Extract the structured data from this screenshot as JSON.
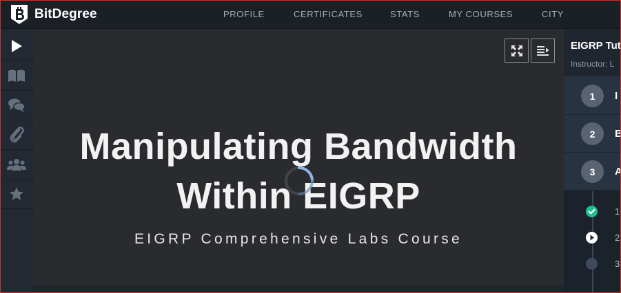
{
  "brand": {
    "name": "BitDegree"
  },
  "nav": {
    "items": [
      "PROFILE",
      "CERTIFICATES",
      "STATS",
      "MY COURSES",
      "CITY"
    ]
  },
  "sidebar": {
    "items": [
      {
        "name": "play-icon",
        "active": true
      },
      {
        "name": "book-icon",
        "active": false
      },
      {
        "name": "chat-icon",
        "active": false
      },
      {
        "name": "paperclip-icon",
        "active": false
      },
      {
        "name": "users-icon",
        "active": false
      },
      {
        "name": "star-icon",
        "active": false
      }
    ]
  },
  "video": {
    "title_line1": "Manipulating Bandwidth",
    "title_line2": "Within EIGRP",
    "subtitle": "EIGRP Comprehensive Labs Course",
    "controls": [
      "fullscreen-icon",
      "playlist-icon"
    ],
    "loading": true
  },
  "course_panel": {
    "title": "EIGRP Tut",
    "instructor": "Instructor: L",
    "sections": [
      {
        "number": "1",
        "initial": "I"
      },
      {
        "number": "2",
        "initial": "B"
      },
      {
        "number": "3",
        "initial": "A"
      }
    ],
    "lessons": [
      {
        "number": "1",
        "status": "completed"
      },
      {
        "number": "2",
        "status": "playing"
      },
      {
        "number": "3",
        "status": "pending"
      }
    ]
  },
  "colors": {
    "accent_green": "#1dbf8e",
    "nav_bg": "#1b2027",
    "video_bg": "#2a2b2f",
    "section_bg": "#283342"
  }
}
